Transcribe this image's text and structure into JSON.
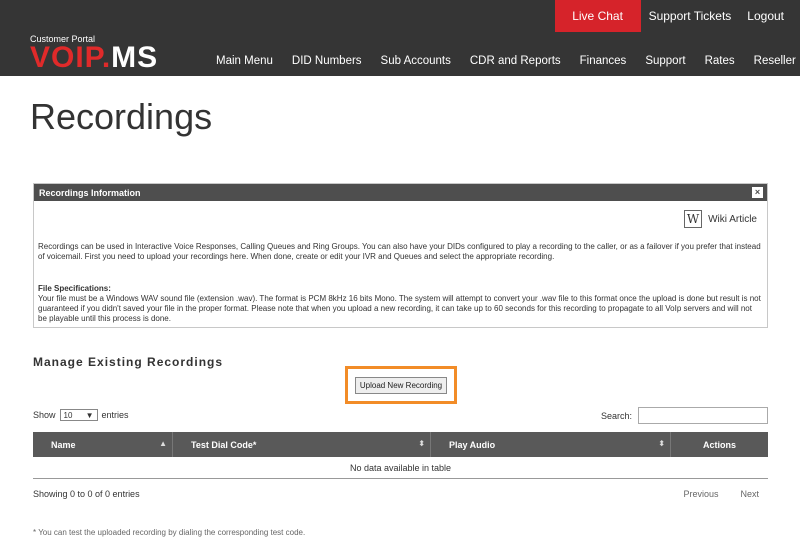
{
  "topbar": {
    "live_chat": "Live Chat",
    "support_tickets": "Support Tickets",
    "logout": "Logout"
  },
  "logo": {
    "subtitle": "Customer Portal",
    "part_red": "VOIP",
    "dot": ".",
    "part_white": "MS"
  },
  "nav": [
    "Main Menu",
    "DID Numbers",
    "Sub Accounts",
    "CDR and Reports",
    "Finances",
    "Support",
    "Rates",
    "Reseller"
  ],
  "page": {
    "title": "Recordings"
  },
  "info": {
    "header": "Recordings Information",
    "wiki_label": "Wiki Article",
    "paragraph1": "Recordings can be used in Interactive Voice Responses, Calling Queues and Ring Groups. You can also have your DIDs configured to play a recording to the caller, or as a failover if you prefer that instead of voicemail. First you need to upload your recordings here. When done, create or edit your IVR and Queues and select the appropriate recording.",
    "spec_heading": "File Specifications:",
    "paragraph2": "Your file must be a Windows WAV sound file (extension .wav). The format is PCM 8kHz 16 bits Mono. The system will attempt to convert your .wav file to this format once the upload is done but result is not guaranteed if you didn't saved your file in the proper format. Please note that when you upload a new recording, it can take up to 60 seconds for this recording to propagate to all VoIp servers and will not be playable until this process is done."
  },
  "manage": {
    "title": "Manage Existing Recordings",
    "upload_label": "Upload New Recording"
  },
  "table_controls": {
    "show": "Show",
    "entries_value": "10",
    "entries": "entries",
    "search_label": "Search:"
  },
  "table": {
    "columns": [
      "Name",
      "Test Dial Code*",
      "Play Audio",
      "Actions"
    ],
    "empty": "No data available in table",
    "info": "Showing 0 to 0 of 0 entries",
    "previous": "Previous",
    "next": "Next"
  },
  "footnote": "* You can test the uploaded recording by dialing the corresponding test code."
}
